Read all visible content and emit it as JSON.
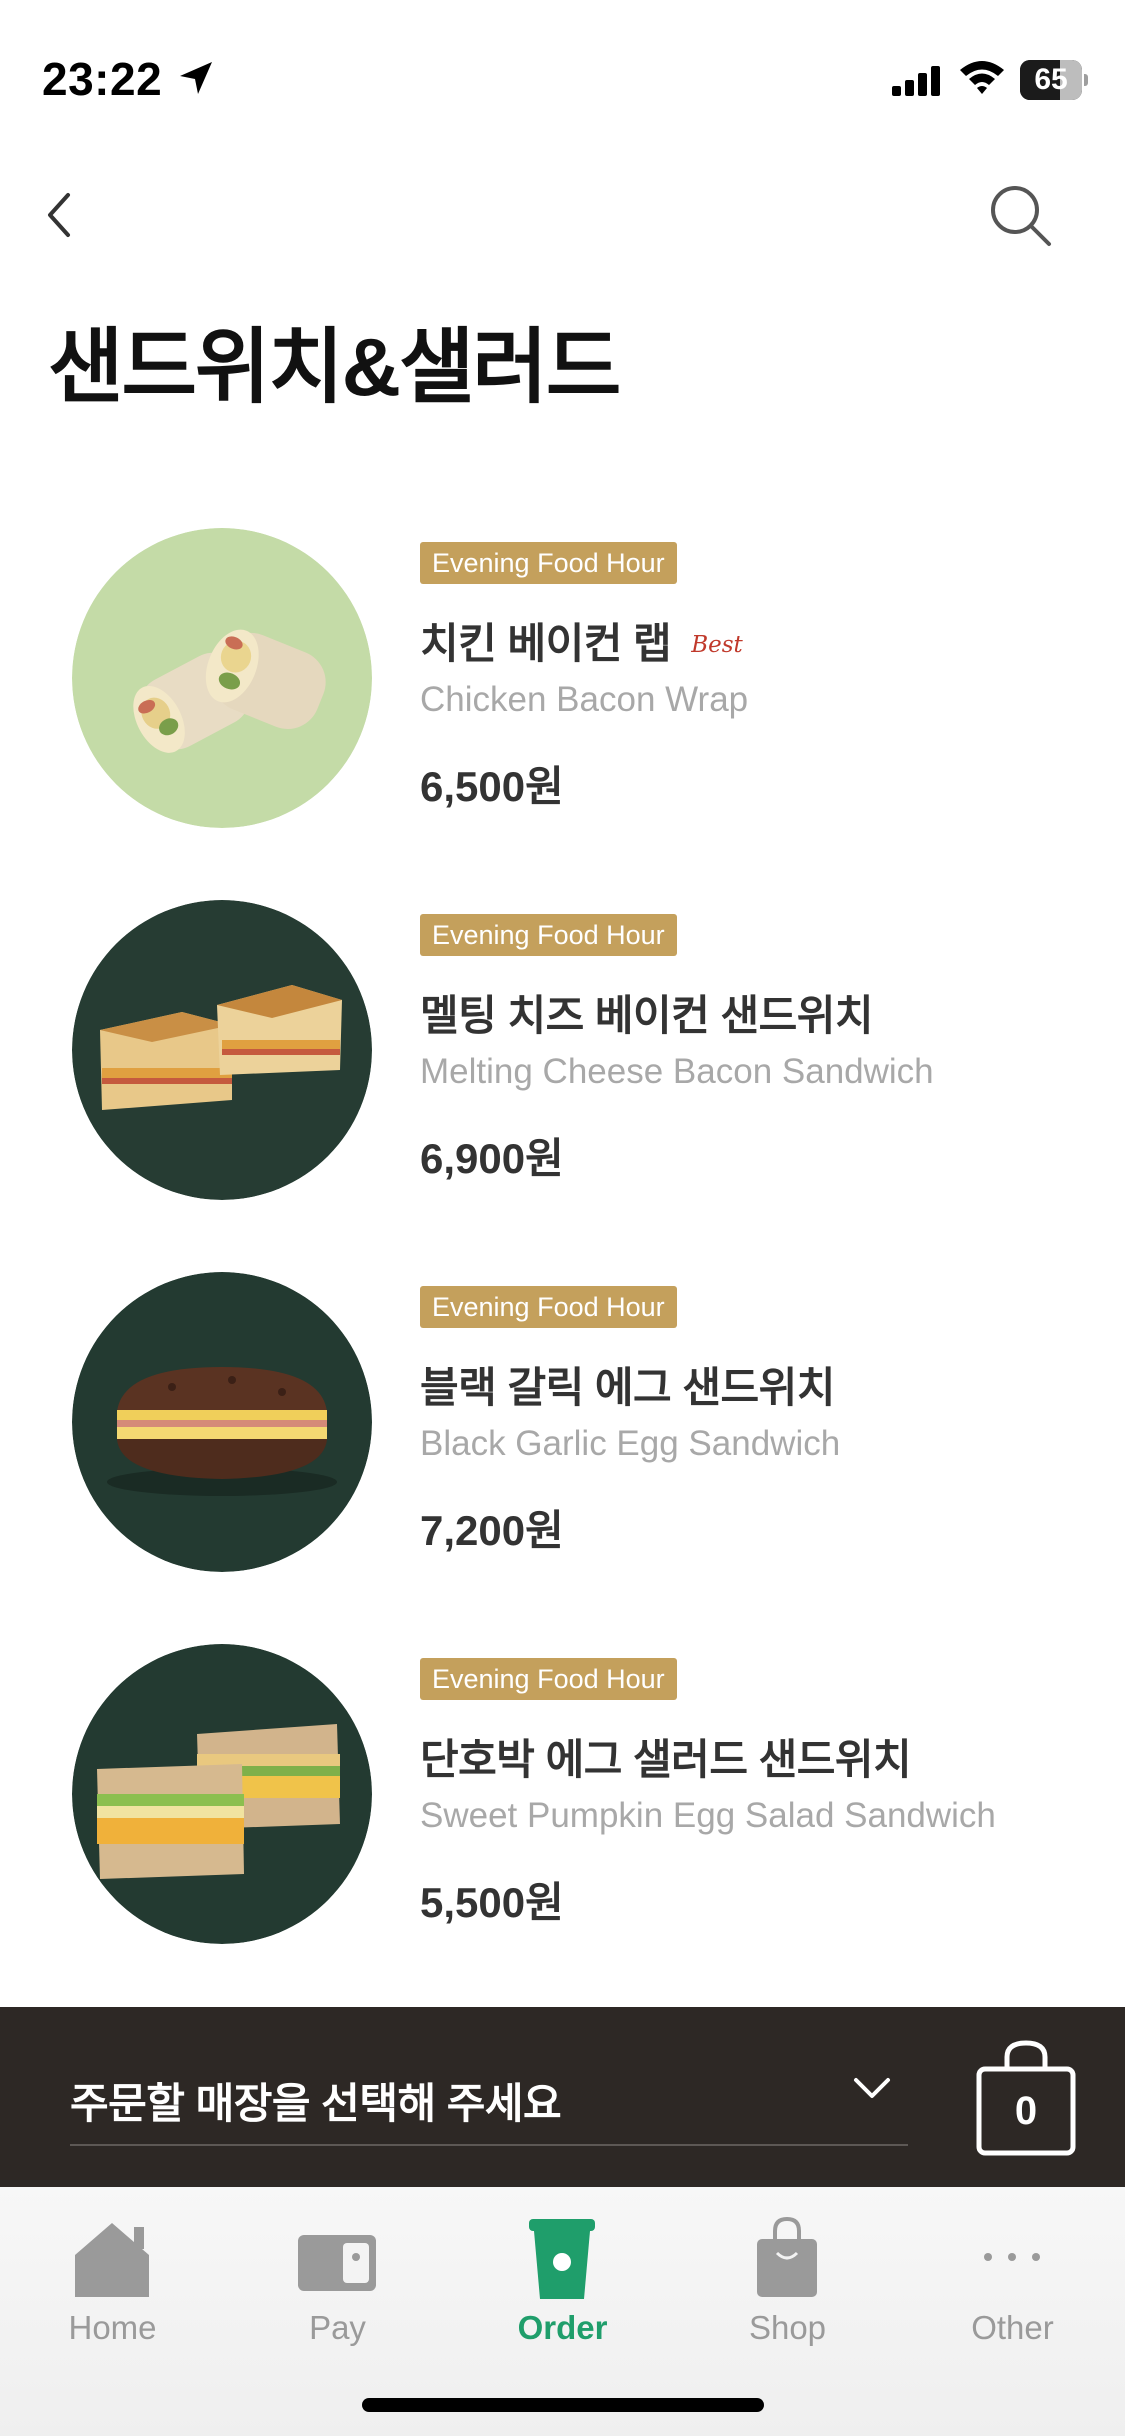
{
  "status_bar": {
    "time": "23:22",
    "battery": "65",
    "battery_level": 0.65
  },
  "header": {
    "title": "샌드위치&샐러드"
  },
  "menu_items": [
    {
      "tag": "Evening Food Hour",
      "name_ko": "치킨 베이컨 랩",
      "badge": "Best",
      "name_en": "Chicken Bacon Wrap",
      "price": "6,500원"
    },
    {
      "tag": "Evening Food Hour",
      "name_ko": "멜팅 치즈 베이컨 샌드위치",
      "badge": "",
      "name_en": "Melting Cheese Bacon Sandwich",
      "price": "6,900원"
    },
    {
      "tag": "Evening Food Hour",
      "name_ko": "블랙 갈릭 에그 샌드위치",
      "badge": "",
      "name_en": "Black Garlic Egg Sandwich",
      "price": "7,200원"
    },
    {
      "tag": "Evening Food Hour",
      "name_ko": "단호박 에그 샐러드 샌드위치",
      "badge": "",
      "name_en": "Sweet Pumpkin Egg Salad Sandwich",
      "price": "5,500원"
    }
  ],
  "store_bar": {
    "placeholder": "주문할 매장을 선택해 주세요",
    "cart_count": "0"
  },
  "tab_bar": [
    {
      "label": "Home",
      "icon": "home-icon",
      "active": false
    },
    {
      "label": "Pay",
      "icon": "card-icon",
      "active": false
    },
    {
      "label": "Order",
      "icon": "cup-icon",
      "active": true
    },
    {
      "label": "Shop",
      "icon": "bag-icon",
      "active": false
    },
    {
      "label": "Other",
      "icon": "more-icon",
      "active": false
    }
  ],
  "colors": {
    "tag": "#c4a05c",
    "accent": "#1f9e6b",
    "store_bar": "#2d2825",
    "best": "#c0392b"
  }
}
